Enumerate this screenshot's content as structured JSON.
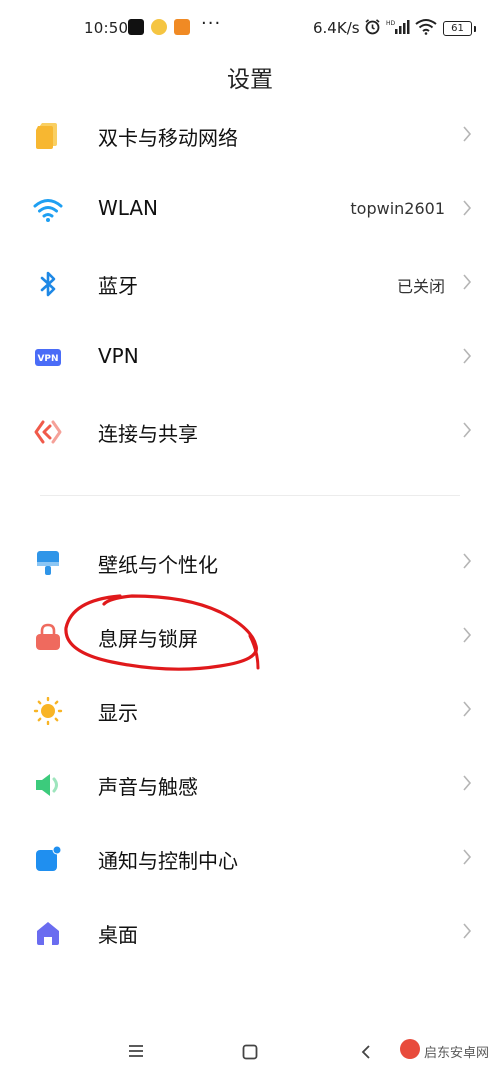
{
  "status_bar": {
    "time": "10:50",
    "more": "···",
    "net_speed": "6.4K/s",
    "battery": "61"
  },
  "page_title": "设置",
  "settings": [
    {
      "label": "双卡与移动网络",
      "value": ""
    },
    {
      "label": "WLAN",
      "value": "topwin2601"
    },
    {
      "label": "蓝牙",
      "value": "已关闭"
    },
    {
      "label": "VPN",
      "value": ""
    },
    {
      "label": "连接与共享",
      "value": ""
    },
    {
      "label": "壁纸与个性化",
      "value": ""
    },
    {
      "label": "息屏与锁屏",
      "value": ""
    },
    {
      "label": "显示",
      "value": ""
    },
    {
      "label": "声音与触感",
      "value": ""
    },
    {
      "label": "通知与控制中心",
      "value": ""
    },
    {
      "label": "桌面",
      "value": ""
    }
  ],
  "icons": {
    "sim": "sim-card-icon",
    "wlan": "wifi-icon",
    "bluetooth": "bluetooth-icon",
    "vpn": "vpn-icon",
    "connection": "connection-share-icon",
    "wallpaper": "wallpaper-brush-icon",
    "lock": "lock-icon",
    "display": "sun-icon",
    "sound": "speaker-icon",
    "notification": "notification-icon",
    "home": "home-icon",
    "vpn_badge_text": "VPN"
  },
  "watermark": "启东安卓网",
  "colors": {
    "sim": "#f7b731",
    "wlan": "#1e9ff2",
    "bluetooth": "#1e88e5",
    "vpn": "#4a6cf7",
    "connection": "#f05a4a",
    "wallpaper": "#2f95e8",
    "lock": "#ef6a5e",
    "display": "#f8b425",
    "sound": "#3ccb7c",
    "notification": "#1f8ff0",
    "home": "#6a6cf0",
    "annotation": "#e0191b"
  }
}
